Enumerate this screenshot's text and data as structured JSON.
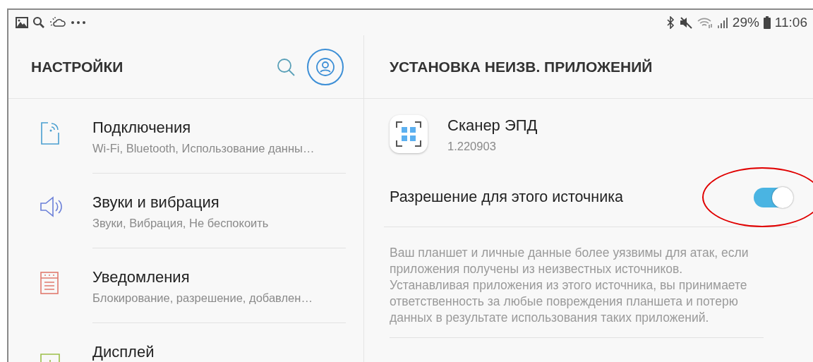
{
  "status_bar": {
    "left_icons": [
      {
        "kind": "picture"
      },
      {
        "kind": "search"
      },
      {
        "kind": "weather"
      },
      {
        "kind": "more"
      }
    ],
    "battery": "29%",
    "time": "11:06"
  },
  "left_pane": {
    "title": "НАСТРОЙКИ",
    "items": [
      {
        "kind": "connections",
        "title": "Подключения",
        "subtitle": "Wi-Fi, Bluetooth, Использование данны…"
      },
      {
        "kind": "sounds",
        "title": "Звуки и вибрация",
        "subtitle": "Звуки, Вибрация, Не беспокоить"
      },
      {
        "kind": "notifications",
        "title": "Уведомления",
        "subtitle": "Блокирование, разрешение, добавлен…"
      },
      {
        "kind": "display",
        "title": "Дисплей"
      }
    ]
  },
  "right_pane": {
    "title": "УСТАНОВКА НЕИЗВ. ПРИЛОЖЕНИЙ",
    "app": {
      "name": "Сканер ЭПД",
      "version": "1.220903"
    },
    "permission": {
      "label": "Разрешение для этого источника",
      "on": true
    },
    "description": "Ваш планшет и личные данные более уязвимы для атак, если приложения получены из неизвестных источников. Устанавливая приложения из этого источника, вы принимаете ответственность за любые повреждения планшета и потерю данных в результате использования таких приложений."
  },
  "annotations": [
    {
      "kind": "ellipse"
    }
  ]
}
